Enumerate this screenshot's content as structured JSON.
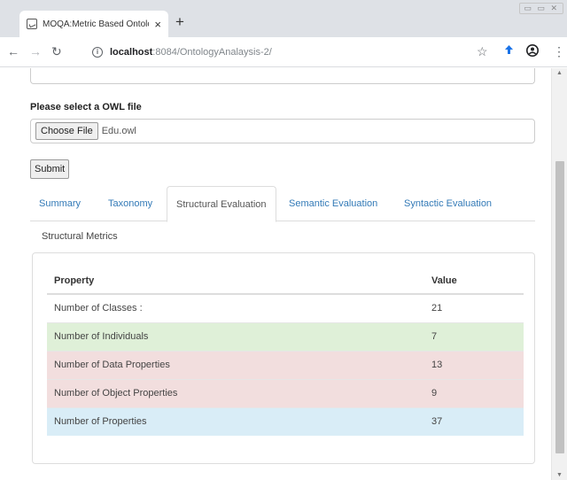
{
  "browser": {
    "tab_title": "MOQA:Metric Based Ontology Q",
    "tab_close": "×",
    "new_tab": "+",
    "url_host": "localhost",
    "url_rest": ":8084/OntologyAnalaysis-2/"
  },
  "form": {
    "select_label": "Please select a OWL file",
    "choose_file_label": "Choose File",
    "file_name": "Edu.owl",
    "submit_label": "Submit"
  },
  "tabs": [
    {
      "label": "Summary"
    },
    {
      "label": "Taxonomy"
    },
    {
      "label": "Structural Evaluation"
    },
    {
      "label": "Semantic Evaluation"
    },
    {
      "label": "Syntactic Evaluation"
    }
  ],
  "active_tab": "Structural Evaluation",
  "metrics": {
    "heading": "Structural Metrics",
    "columns": [
      "Property",
      "Value"
    ],
    "rows": [
      {
        "property": "Number of Classes :",
        "value": "21",
        "status": "default"
      },
      {
        "property": "Number of Individuals",
        "value": "7",
        "status": "success"
      },
      {
        "property": "Number of Data Properties",
        "value": "13",
        "status": "danger"
      },
      {
        "property": "Number of Object Properties",
        "value": "9",
        "status": "danger"
      },
      {
        "property": "Number of Properties",
        "value": "37",
        "status": "info"
      }
    ]
  },
  "colors": {
    "link": "#337ab7",
    "success_row": "#dff0d8",
    "danger_row": "#f2dede",
    "info_row": "#d9edf7",
    "account_icon": "#202124",
    "extension_icon": "#1a73e8"
  },
  "icons": {
    "back": "arrow-left-icon",
    "forward": "arrow-right-icon",
    "reload": "reload-icon",
    "info": "info-icon",
    "bookmark": "star-icon",
    "extension": "extension-icon",
    "account": "account-icon",
    "menu": "kebab-menu-icon"
  }
}
